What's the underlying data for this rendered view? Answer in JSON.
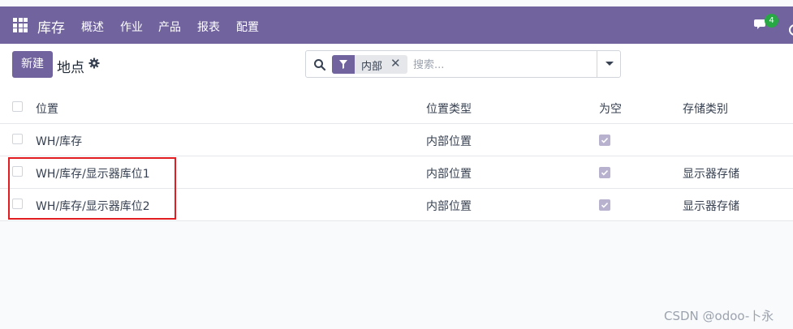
{
  "navbar": {
    "app_name": "库存",
    "menu": [
      "概述",
      "作业",
      "产品",
      "报表",
      "配置"
    ],
    "chat_badge_count": "4",
    "color": "#71639e"
  },
  "control": {
    "new_button": "新建",
    "title": "地点",
    "search": {
      "facet_label": "内部",
      "placeholder": "搜索..."
    }
  },
  "table": {
    "headers": [
      "位置",
      "位置类型",
      "为空",
      "存储类别"
    ],
    "rows": [
      {
        "name": "WH/库存",
        "type": "内部位置",
        "empty": true,
        "storage": ""
      },
      {
        "name": "WH/库存/显示器库位1",
        "type": "内部位置",
        "empty": true,
        "storage": "显示器存储"
      },
      {
        "name": "WH/库存/显示器库位2",
        "type": "内部位置",
        "empty": true,
        "storage": "显示器存储"
      }
    ]
  },
  "watermark": "CSDN @odoo-卜永"
}
